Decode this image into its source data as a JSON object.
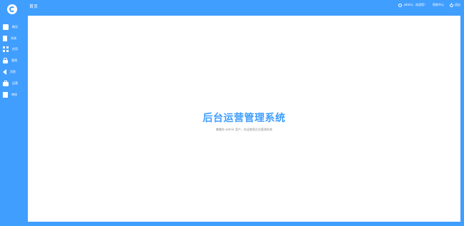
{
  "sidebar": {
    "items": [
      {
        "label": "概况",
        "icon": "card-icon"
      },
      {
        "label": "系统",
        "icon": "document-icon"
      },
      {
        "label": "应用",
        "icon": "grid-icon"
      },
      {
        "label": "管理",
        "icon": "lock-icon"
      },
      {
        "label": "消息",
        "icon": "speaker-icon"
      },
      {
        "label": "运营",
        "icon": "briefcase-icon"
      },
      {
        "label": "审核",
        "icon": "edit-icon"
      }
    ]
  },
  "header": {
    "title": "首页",
    "user_greeting": "admin，欢迎您！",
    "help_label": "帮助中心",
    "logout_label": "退出"
  },
  "main": {
    "title": "后台运营管理系统",
    "subtitle": "尊敬的 admin 用户，欢迎使用后台管理系统"
  },
  "colors": {
    "primary": "#409eff",
    "content_bg": "#ffffff",
    "subtitle": "#8c8c8c"
  }
}
